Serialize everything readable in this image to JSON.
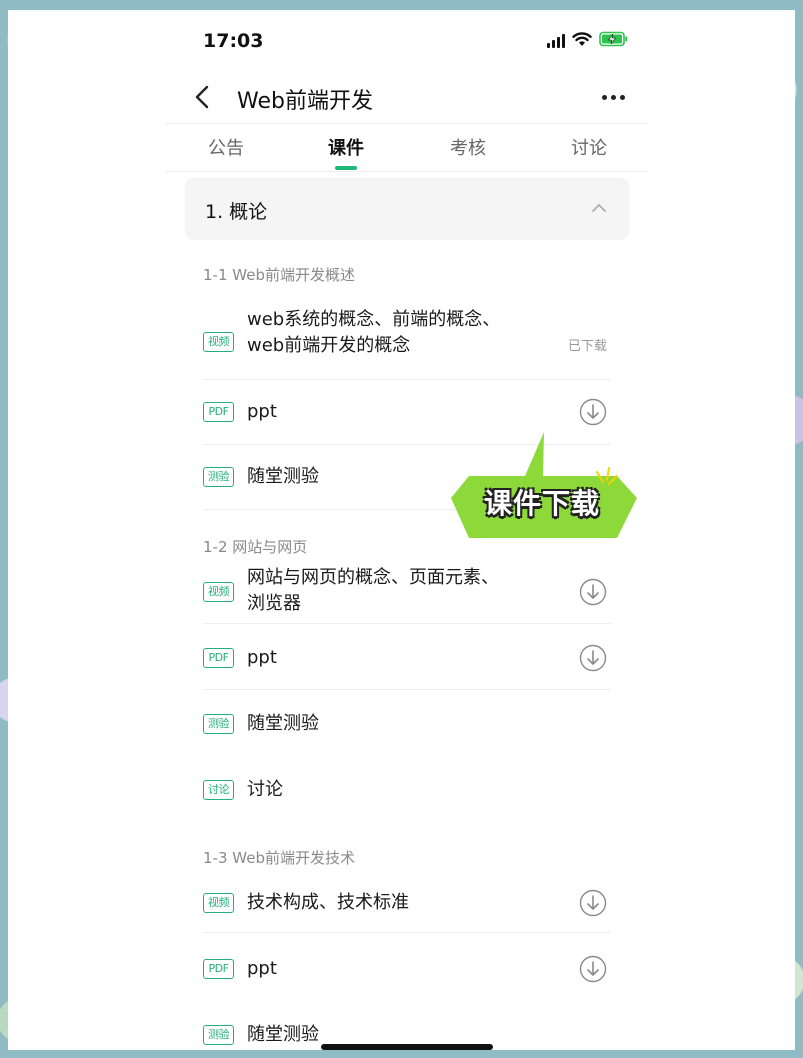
{
  "status_bar": {
    "time": "17:03"
  },
  "nav": {
    "title": "Web前端开发"
  },
  "tabs": [
    {
      "label": "公告",
      "active": false
    },
    {
      "label": "课件",
      "active": true
    },
    {
      "label": "考核",
      "active": false
    },
    {
      "label": "讨论",
      "active": false
    }
  ],
  "chapter": {
    "title": "1. 概论",
    "expanded": true
  },
  "sections": [
    {
      "title": "1-1 Web前端开发概述",
      "items": [
        {
          "tag": "视频",
          "label_line1": "web系统的概念、前端的概念、",
          "label_line2": "web前端开发的概念",
          "status": "已下载"
        },
        {
          "tag": "PDF",
          "label": "ppt",
          "icon": "download-icon"
        },
        {
          "tag": "测验",
          "label": "随堂测验"
        }
      ]
    },
    {
      "title": "1-2 网站与网页",
      "items": [
        {
          "tag": "视频",
          "label_line1": "网站与网页的概念、页面元素、",
          "label_line2": "浏览器",
          "icon": "download-icon"
        },
        {
          "tag": "PDF",
          "label": "ppt",
          "icon": "download-icon"
        },
        {
          "tag": "测验",
          "label": "随堂测验"
        },
        {
          "tag": "讨论",
          "label": "讨论"
        }
      ]
    },
    {
      "title": "1-3 Web前端开发技术",
      "items": [
        {
          "tag": "视频",
          "label": "技术构成、技术标准",
          "icon": "download-icon"
        },
        {
          "tag": "PDF",
          "label": "ppt",
          "icon": "download-icon"
        },
        {
          "tag": "测验",
          "label": "随堂测验"
        }
      ]
    }
  ],
  "annotation": {
    "text": "课件下载",
    "color": "#8ed93a"
  },
  "colors": {
    "accent": "#1fb876",
    "tag_green": "#25b07a"
  }
}
